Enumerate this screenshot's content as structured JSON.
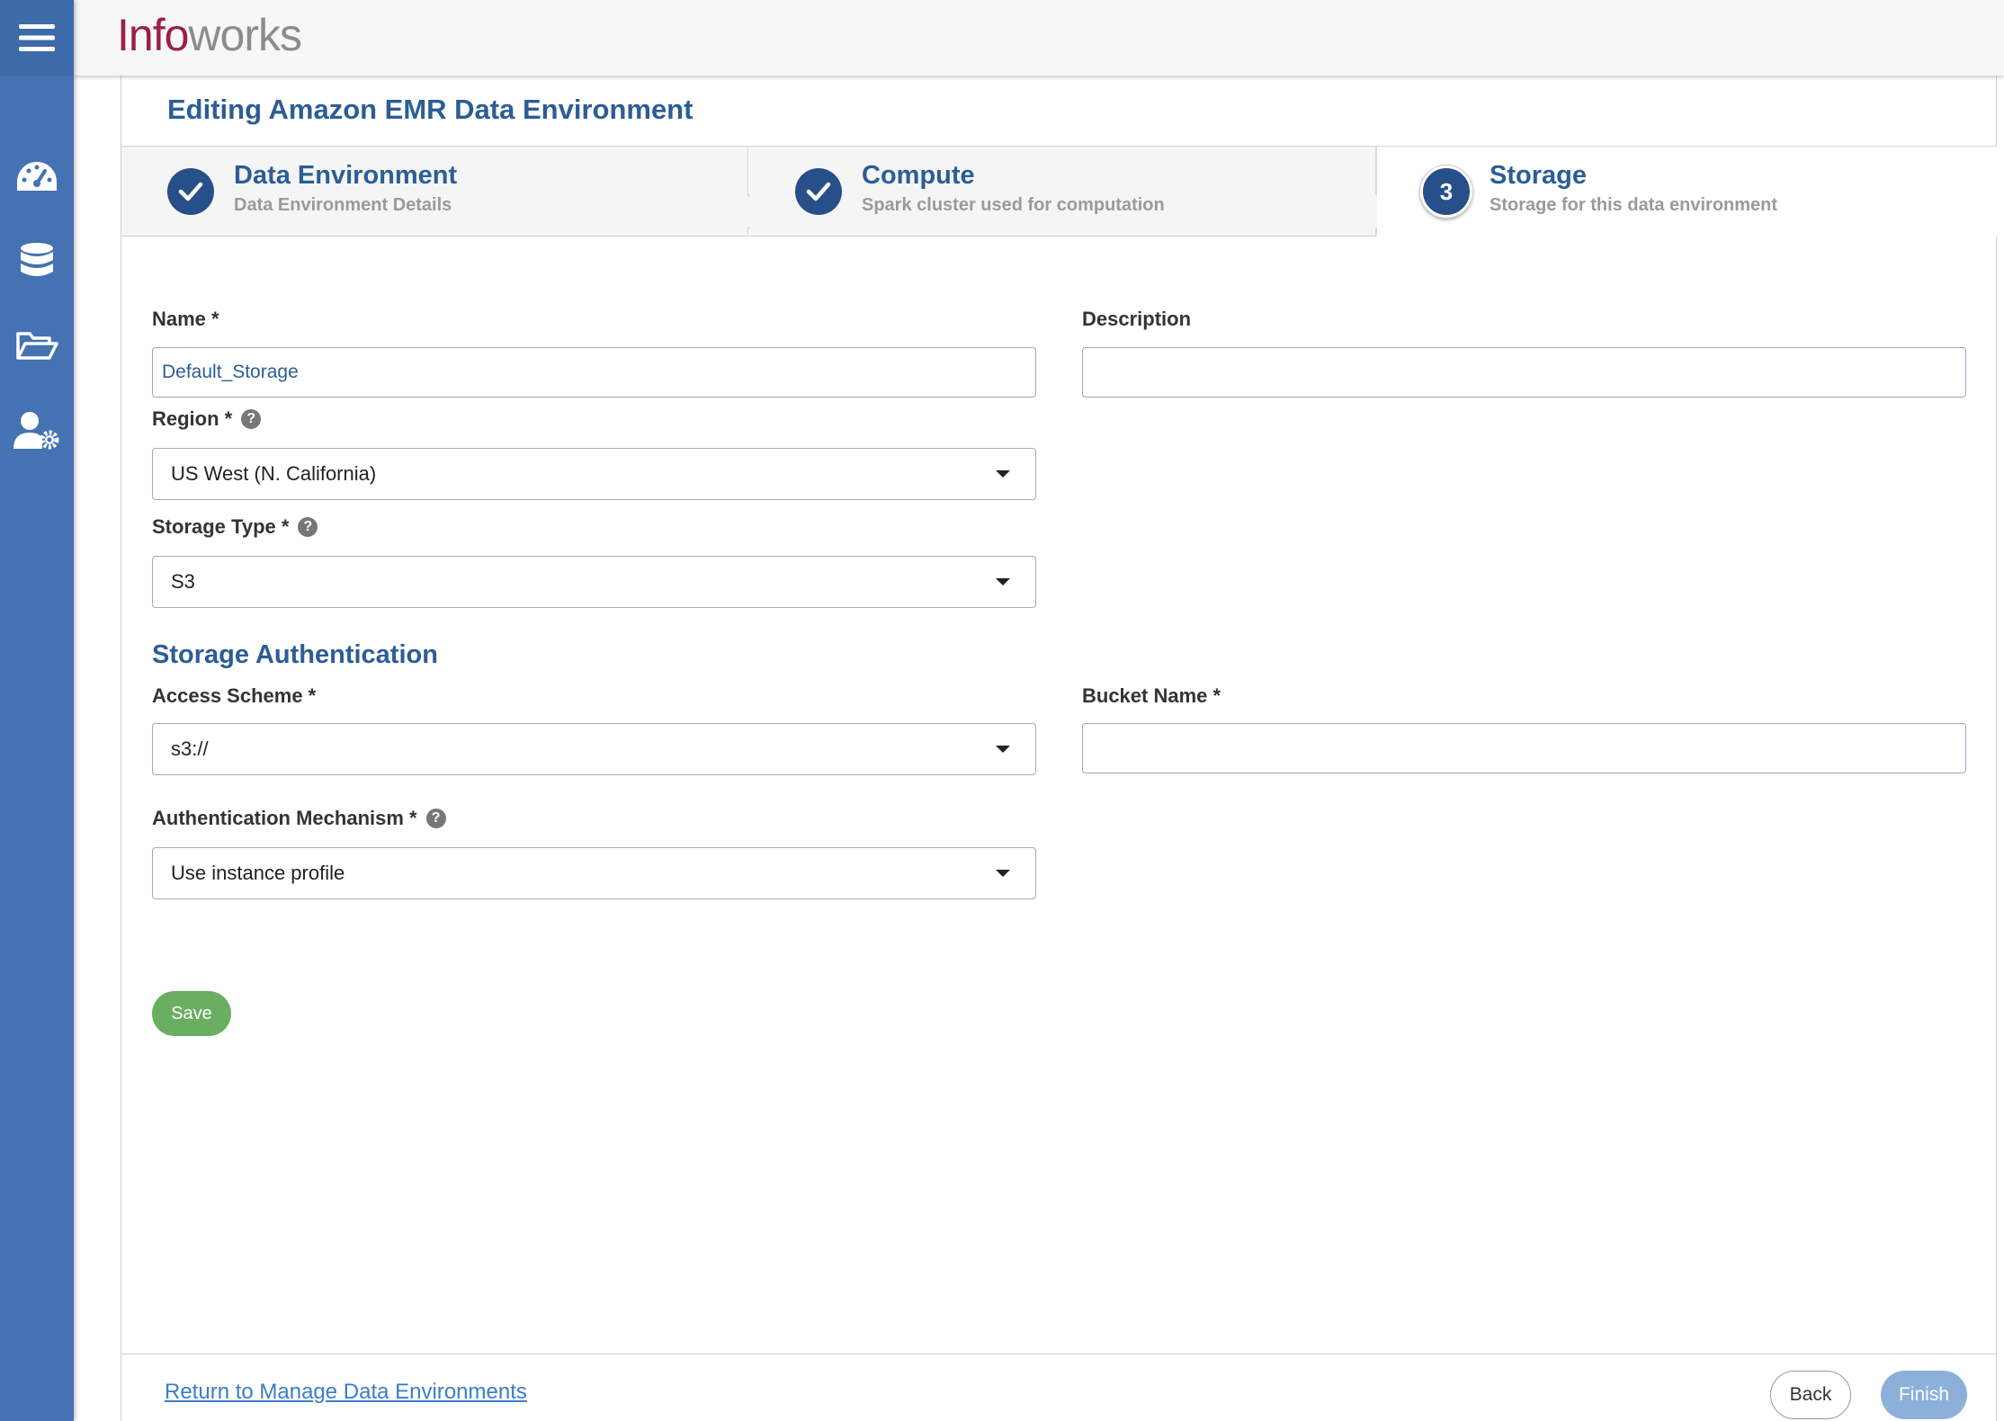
{
  "app": {
    "logo_part1": "Info",
    "logo_part2": "works"
  },
  "sidebar": {
    "items": [
      {
        "icon": "menu-icon"
      },
      {
        "icon": "dashboard-icon"
      },
      {
        "icon": "database-icon"
      },
      {
        "icon": "folder-icon"
      },
      {
        "icon": "user-settings-icon"
      }
    ]
  },
  "page": {
    "title": "Editing Amazon EMR Data Environment"
  },
  "steps": [
    {
      "number": "",
      "title": "Data Environment",
      "subtitle": "Data Environment Details",
      "status": "complete"
    },
    {
      "number": "",
      "title": "Compute",
      "subtitle": "Spark cluster used for computation",
      "status": "complete"
    },
    {
      "number": "3",
      "title": "Storage",
      "subtitle": "Storage for this data environment",
      "status": "active"
    }
  ],
  "form": {
    "name_label": "Name *",
    "name_value": "Default_Storage",
    "description_label": "Description",
    "description_value": "",
    "region_label": "Region *",
    "region_value": "US West (N. California)",
    "storage_type_label": "Storage Type *",
    "storage_type_value": "S3",
    "auth_section_title": "Storage Authentication",
    "access_scheme_label": "Access Scheme *",
    "access_scheme_value": "s3://",
    "bucket_name_label": "Bucket Name *",
    "bucket_name_value": "",
    "auth_mechanism_label": "Authentication Mechanism *",
    "auth_mechanism_value": "Use instance profile",
    "help_glyph": "?",
    "save_label": "Save"
  },
  "footer": {
    "return_link": "Return to Manage Data Environments",
    "back_label": "Back",
    "finish_label": "Finish"
  },
  "colors": {
    "sidebar": "#4472b3",
    "brand_primary": "#9a1f45",
    "heading_blue": "#2c5d96",
    "save_green": "#6aae61",
    "finish_disabled": "#8cb0da"
  }
}
